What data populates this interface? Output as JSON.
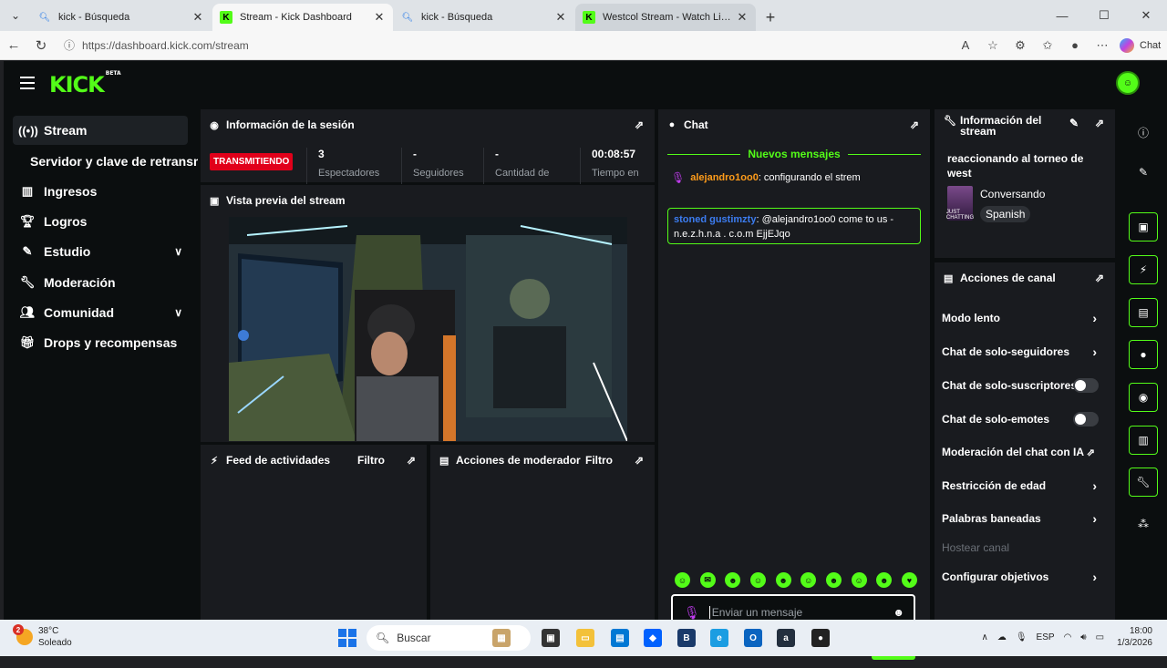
{
  "browser": {
    "tabs": [
      {
        "title": "kick - Búsqueda",
        "icon": "search-icon"
      },
      {
        "title": "Stream - Kick Dashboard",
        "icon": "kick-icon"
      },
      {
        "title": "kick - Búsqueda",
        "icon": "search-icon"
      },
      {
        "title": "Westcol Stream - Watch Live on Kick",
        "icon": "kick-icon"
      }
    ],
    "url": "https://dashboard.kick.com/stream",
    "copilot_label": "Chat"
  },
  "app": {
    "logo_text": "KICK",
    "logo_badge": "BETA",
    "accent_color": "#53fc18"
  },
  "sidebar": {
    "items": [
      {
        "label": "Stream",
        "icon": "broadcast-icon"
      },
      {
        "label": "Servidor y clave de retransmisión"
      },
      {
        "label": "Ingresos",
        "icon": "chart-icon"
      },
      {
        "label": "Logros",
        "icon": "trophy-icon"
      },
      {
        "label": "Estudio",
        "icon": "brush-icon"
      },
      {
        "label": "Moderación",
        "icon": "wrench-icon"
      },
      {
        "label": "Comunidad",
        "icon": "people-icon"
      },
      {
        "label": "Drops y recompensas",
        "icon": "gift-icon"
      }
    ]
  },
  "session": {
    "title": "Información de la sesión",
    "live_label": "TRANSMITIENDO",
    "stats": [
      {
        "value": "3",
        "label": "Espectadores"
      },
      {
        "value": "-",
        "label": "Seguidores"
      },
      {
        "value": "-",
        "label": "Cantidad de"
      },
      {
        "value": "00:08:57",
        "label": "Tiempo en"
      }
    ]
  },
  "preview": {
    "title": "Vista previa del stream"
  },
  "activity": {
    "title": "Feed de actividades",
    "filter": "Filtro"
  },
  "modactions": {
    "title": "Acciones de moderador",
    "filter": "Filtro"
  },
  "chat": {
    "title": "Chat",
    "new_messages": "Nuevos mensajes",
    "messages": [
      {
        "user": "alejandro1oo0",
        "text": ": configurando el strem"
      },
      {
        "user": "stoned gustimzty",
        "text": ": @alejandro1oo0 come to us - n.e.z.h.n.a . c.o.m EjjEJqo"
      }
    ],
    "input_placeholder": "Enviar un mensaje",
    "send_label": "Chat"
  },
  "stream_info": {
    "title": "Información del stream",
    "stream_title": "reaccionando al torneo de west",
    "category": "Conversando",
    "category_thumb_text": "JUST CHATTING",
    "language": "Spanish"
  },
  "channel_actions": {
    "title": "Acciones de canal",
    "items": [
      {
        "label": "Modo lento"
      },
      {
        "label": "Chat de solo-seguidores"
      },
      {
        "label": "Chat de solo-suscriptores",
        "toggle": false
      },
      {
        "label": "Chat de solo-emotes",
        "toggle": false
      },
      {
        "label": "Moderación del chat con IA"
      },
      {
        "label": "Restricción de edad"
      },
      {
        "label": "Palabras baneadas"
      },
      {
        "label": "Hostear canal",
        "disabled": true
      },
      {
        "label": "Configurar objetivos"
      }
    ]
  },
  "taskbar": {
    "weather_temp": "38°C",
    "weather_desc": "Soleado",
    "weather_badge": "2",
    "search_label": "Buscar",
    "lang": "ESP",
    "time": "18:00",
    "date": "1/3/2026"
  }
}
